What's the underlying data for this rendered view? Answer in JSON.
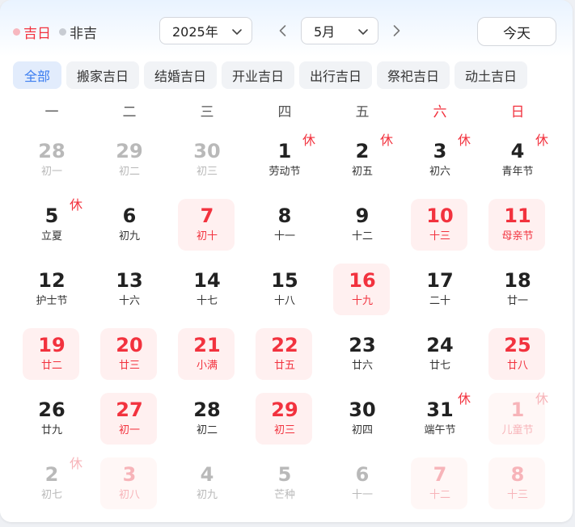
{
  "legend": {
    "lucky": "吉日",
    "unlucky": "非吉"
  },
  "year_select": {
    "value": "2025年"
  },
  "month_select": {
    "value": "5月"
  },
  "today_label": "今天",
  "tabs": [
    "全部",
    "搬家吉日",
    "结婚吉日",
    "开业吉日",
    "出行吉日",
    "祭祀吉日",
    "动土吉日"
  ],
  "weekdays": [
    "一",
    "二",
    "三",
    "四",
    "五",
    "六",
    "日"
  ],
  "rest_label": "休",
  "colors": {
    "lucky": "#f2323e",
    "accent": "#3b7df0",
    "lucky_bg": "#fff0f0"
  },
  "weeks": [
    [
      {
        "day": "28",
        "sub": "初一",
        "faded": true
      },
      {
        "day": "29",
        "sub": "初二",
        "faded": true
      },
      {
        "day": "30",
        "sub": "初三",
        "faded": true
      },
      {
        "day": "1",
        "sub": "劳动节",
        "rest": true
      },
      {
        "day": "2",
        "sub": "初五",
        "rest": true
      },
      {
        "day": "3",
        "sub": "初六",
        "rest": true
      },
      {
        "day": "4",
        "sub": "青年节",
        "rest": true
      }
    ],
    [
      {
        "day": "5",
        "sub": "立夏",
        "rest": true
      },
      {
        "day": "6",
        "sub": "初九"
      },
      {
        "day": "7",
        "sub": "初十",
        "good": true
      },
      {
        "day": "8",
        "sub": "十一"
      },
      {
        "day": "9",
        "sub": "十二"
      },
      {
        "day": "10",
        "sub": "十三",
        "good": true
      },
      {
        "day": "11",
        "sub": "母亲节",
        "good": true
      }
    ],
    [
      {
        "day": "12",
        "sub": "护士节"
      },
      {
        "day": "13",
        "sub": "十六"
      },
      {
        "day": "14",
        "sub": "十七"
      },
      {
        "day": "15",
        "sub": "十八"
      },
      {
        "day": "16",
        "sub": "十九",
        "good": true
      },
      {
        "day": "17",
        "sub": "二十"
      },
      {
        "day": "18",
        "sub": "廿一"
      }
    ],
    [
      {
        "day": "19",
        "sub": "廿二",
        "good": true
      },
      {
        "day": "20",
        "sub": "廿三",
        "good": true
      },
      {
        "day": "21",
        "sub": "小满",
        "good": true
      },
      {
        "day": "22",
        "sub": "廿五",
        "good": true
      },
      {
        "day": "23",
        "sub": "廿六"
      },
      {
        "day": "24",
        "sub": "廿七"
      },
      {
        "day": "25",
        "sub": "廿八",
        "good": true
      }
    ],
    [
      {
        "day": "26",
        "sub": "廿九"
      },
      {
        "day": "27",
        "sub": "初一",
        "good": true
      },
      {
        "day": "28",
        "sub": "初二"
      },
      {
        "day": "29",
        "sub": "初三",
        "good": true
      },
      {
        "day": "30",
        "sub": "初四"
      },
      {
        "day": "31",
        "sub": "端午节",
        "rest": true
      },
      {
        "day": "1",
        "sub": "儿童节",
        "rest": true,
        "faded": true,
        "good": true
      }
    ],
    [
      {
        "day": "2",
        "sub": "初七",
        "rest": true,
        "faded": true
      },
      {
        "day": "3",
        "sub": "初八",
        "faded": true,
        "good": true
      },
      {
        "day": "4",
        "sub": "初九",
        "faded": true
      },
      {
        "day": "5",
        "sub": "芒种",
        "faded": true
      },
      {
        "day": "6",
        "sub": "十一",
        "faded": true
      },
      {
        "day": "7",
        "sub": "十二",
        "faded": true,
        "good": true
      },
      {
        "day": "8",
        "sub": "十三",
        "faded": true,
        "good": true
      }
    ]
  ]
}
